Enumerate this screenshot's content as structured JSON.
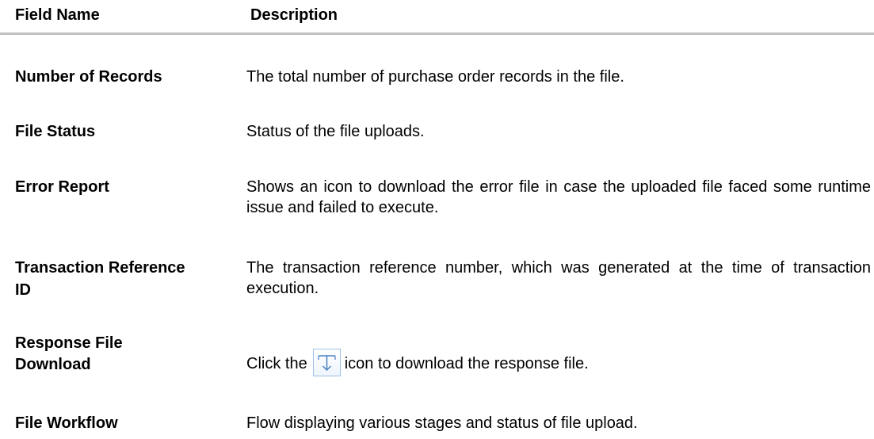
{
  "header": {
    "field_name": "Field Name",
    "description": "Description"
  },
  "rows": [
    {
      "field": "Number of Records",
      "description": "The total number of purchase order records in the file."
    },
    {
      "field": "File Status",
      "description": "Status of the file uploads."
    },
    {
      "field": "Error Report",
      "description": "Shows an icon to download the error file in case the uploaded file faced some runtime issue and failed to execute."
    },
    {
      "field_line1": "Transaction Reference",
      "field_line2": "ID",
      "description": "The transaction reference number, which was generated at the time of transaction execution."
    },
    {
      "field_line1": "Response File",
      "field_line2": "Download",
      "description_before": "Click the",
      "description_after": "icon to download the response file.",
      "icon": "download-icon"
    },
    {
      "field": "File Workflow",
      "description": "Flow displaying various stages and status of file upload."
    }
  ],
  "colors": {
    "header_rule": "#c0c0c0",
    "icon_border": "#9ec1e6",
    "icon_arrow": "#4a7fc1"
  }
}
